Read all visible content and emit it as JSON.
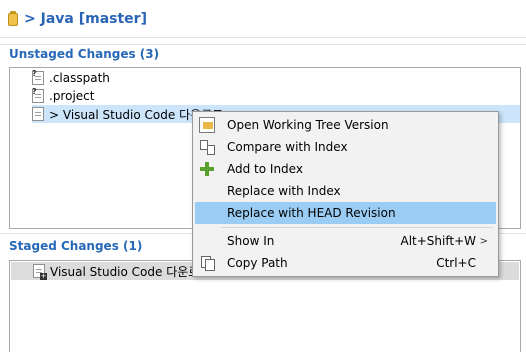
{
  "header": {
    "title": "> Java [master]"
  },
  "unstaged": {
    "title": "Unstaged Changes (3)",
    "items": [
      {
        "label": ".classpath",
        "icon": "classpath-file-icon"
      },
      {
        "label": ".project",
        "icon": "project-file-icon"
      },
      {
        "label": "> Visual Studio Code 다운로드",
        "icon": "text-file-icon"
      }
    ]
  },
  "staged": {
    "title": "Staged Changes (1)",
    "items": [
      {
        "label": "Visual Studio Code 다운로드",
        "icon": "staged-file-icon"
      }
    ]
  },
  "context_menu": {
    "items": [
      {
        "label": "Open Working Tree Version",
        "icon": "open-file-icon"
      },
      {
        "label": "Compare with Index",
        "icon": "compare-icon"
      },
      {
        "label": "Add to Index",
        "icon": "add-plus-icon"
      },
      {
        "label": "Replace with Index"
      },
      {
        "label": "Replace with HEAD Revision",
        "highlighted": true
      },
      {
        "label": "Show In",
        "accelerator": "Alt+Shift+W",
        "submenu_arrow": ">"
      },
      {
        "label": "Copy Path",
        "accelerator": "Ctrl+C",
        "icon": "copy-icon"
      }
    ]
  },
  "colors": {
    "section_title": "#2868b8",
    "header_title": "#2a64b5",
    "selection": "#cde5fb",
    "menu_highlight": "#9bcdf4",
    "add_icon": "#5aa02c"
  }
}
